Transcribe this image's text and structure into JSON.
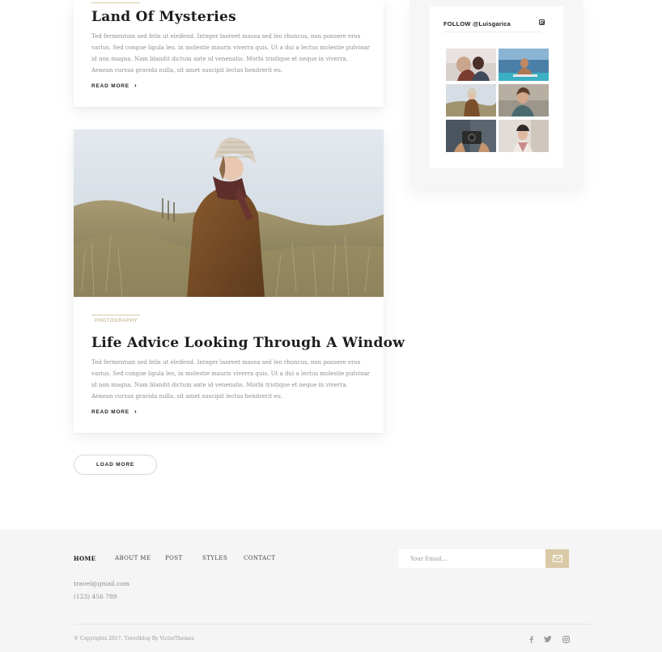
{
  "posts": [
    {
      "title": "Land Of Mysteries",
      "excerpt": "Ted fermentum sed felis ut eleifend. Integer laoreet massa sed leo rhoncus, non posuere eros varius. Sed congue ligula leo, in molestie mauris viverra quis. Ut a dui a lectus molestie pulvinar id non magna. Nam blandit dictum ante id venenatis. Morbi tristique et neque in viverra. Aenean cursus gravida nulla, sit amet suscipit lectus hendrerit eu.",
      "read_more": "READ MORE"
    },
    {
      "category": "PHOTOGRAPHY",
      "title": "Life Advice Looking Through A Window",
      "excerpt": "Ted fermentum sed felis ut eleifend. Integer laoreet massa sed leo rhoncus, non posuere eros varius. Sed congue ligula leo, in molestie mauris viverra quis. Ut a dui a lectus molestie pulvinar id non magna. Nam blandit dictum ante id venenatis. Morbi tristique et neque in viverra. Aenean cursus gravida nulla, sit amet suscipit lectus hendrerit eu.",
      "read_more": "READ MORE"
    }
  ],
  "load_more_label": "LOAD MORE",
  "instagram": {
    "title": "FOLLOW @Luisgarica",
    "icon": "instagram-icon"
  },
  "footer": {
    "nav": [
      "HOME",
      "ABOUT ME",
      "POST",
      "STYLES",
      "CONTACT"
    ],
    "active_nav": "HOME",
    "email": "travel@gmail.com",
    "phone": "(123) 456 789",
    "newsletter_placeholder": "Your Email...",
    "copyright": "© Copyrights 2017. Travelblog By VictorThemes",
    "social_icons": [
      "facebook-icon",
      "twitter-icon",
      "instagram-icon"
    ]
  },
  "colors": {
    "accent": "#d9c9a6",
    "footer_bg": "#f5f5f5",
    "category_text": "#b9a27b"
  }
}
